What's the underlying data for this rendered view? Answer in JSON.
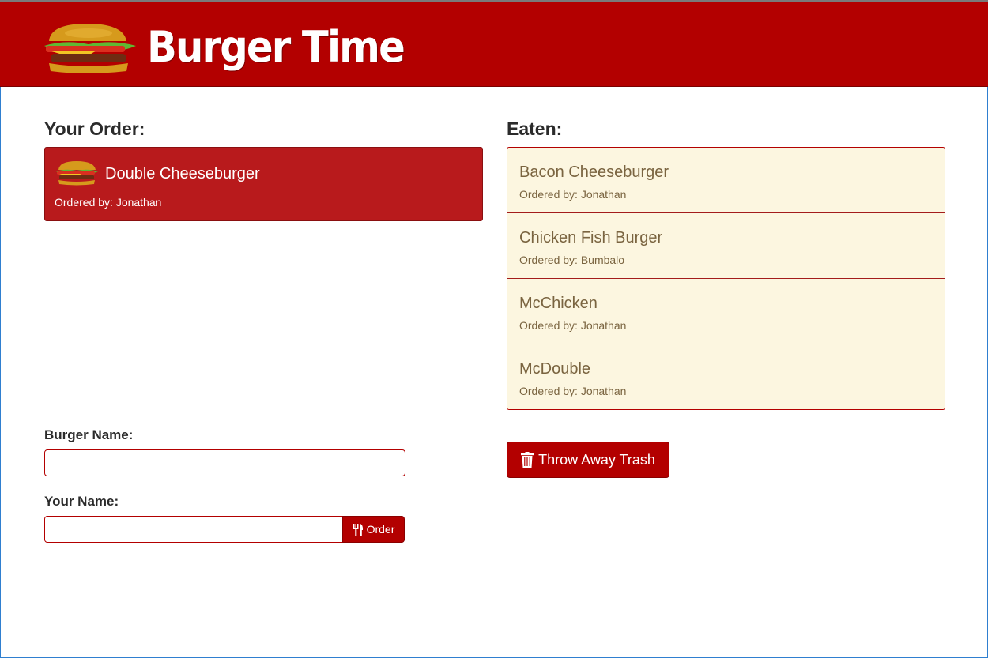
{
  "header": {
    "title": "Burger Time",
    "logo_icon": "burger-icon",
    "background": "#b30000"
  },
  "order_section": {
    "title": "Your Order:",
    "items": [
      {
        "name": "Double Cheeseburger",
        "ordered_by": "Ordered by: Jonathan",
        "icon": "burger-icon"
      }
    ]
  },
  "eaten_section": {
    "title": "Eaten:",
    "items": [
      {
        "name": "Bacon Cheeseburger",
        "ordered_by": "Ordered by: Jonathan"
      },
      {
        "name": "Chicken Fish Burger",
        "ordered_by": "Ordered by: Bumbalo"
      },
      {
        "name": "McChicken",
        "ordered_by": "Ordered by: Jonathan"
      },
      {
        "name": "McDouble",
        "ordered_by": "Ordered by: Jonathan"
      }
    ]
  },
  "form": {
    "burger_name_label": "Burger Name:",
    "burger_name_value": "",
    "your_name_label": "Your Name:",
    "your_name_value": "",
    "order_button_label": "Order",
    "order_button_icon": "cutlery-icon"
  },
  "trash_button": {
    "label": "Throw Away Trash",
    "icon": "trash-icon"
  },
  "colors": {
    "accent": "#b30000",
    "order_card": "#b81a1c",
    "eaten_bg": "#fcf6e0",
    "eaten_text": "#7a6440"
  }
}
